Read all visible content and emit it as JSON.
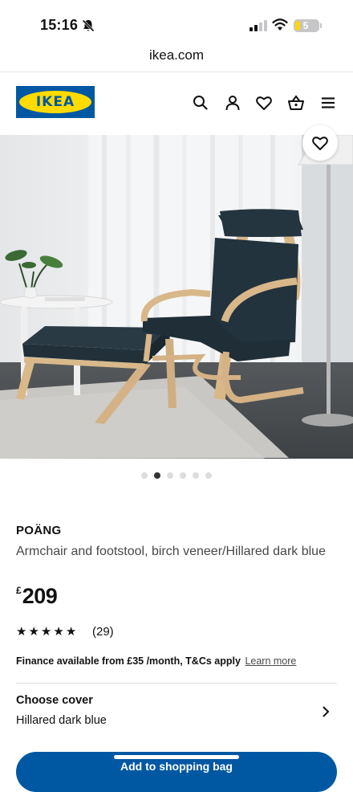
{
  "status_bar": {
    "time": "15:16",
    "battery_level": "5",
    "icons": [
      "bell-off-icon",
      "signal-icon",
      "wifi-icon",
      "battery-icon"
    ]
  },
  "browser": {
    "url": "ikea.com"
  },
  "header": {
    "logo_text": "IKEA",
    "icons": [
      "search-icon",
      "account-icon",
      "heart-icon",
      "basket-icon",
      "menu-icon"
    ]
  },
  "gallery": {
    "image_count": 6,
    "active_index": 1
  },
  "product": {
    "name": "POÄNG",
    "description": "Armchair and footstool, birch veneer/Hillared dark blue",
    "currency": "£",
    "price": "209",
    "rating": 5,
    "rating_max": 5,
    "review_count": "(29)",
    "finance_text": "Finance available from £35 /month, T&Cs apply",
    "finance_link": "Learn more"
  },
  "cover": {
    "title": "Choose cover",
    "value": "Hillared dark blue"
  },
  "cart": {
    "label": "Add to shopping bag"
  },
  "colors": {
    "brand_blue": "#0058a3",
    "brand_yellow": "#ffdb00"
  }
}
